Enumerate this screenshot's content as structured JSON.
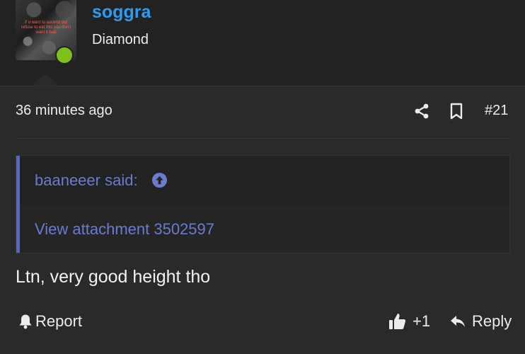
{
  "user": {
    "username": "soggra",
    "rank": "Diamond",
    "avatar_caption": "if u want to ascend but refuse to eat this you don't want it bad",
    "online_color": "#7cc01c"
  },
  "post": {
    "timestamp": "36 minutes ago",
    "number": "#21",
    "quote": {
      "author": "baaneeer said:",
      "attachment_text": "View attachment 3502597"
    },
    "message": "Ltn, very good height tho"
  },
  "actions": {
    "report_label": "Report",
    "like_count": "+1",
    "reply_label": "Reply"
  },
  "icons": {
    "share": "share-icon",
    "bookmark": "bookmark-icon",
    "goto": "arrow-up-circle-icon",
    "report": "bell-icon",
    "like": "thumbs-up-icon",
    "reply": "reply-arrow-icon"
  },
  "colors": {
    "username": "#2f9bef",
    "link": "#6a7bd0",
    "quote_bar": "#5468c8",
    "background": "#222222"
  }
}
